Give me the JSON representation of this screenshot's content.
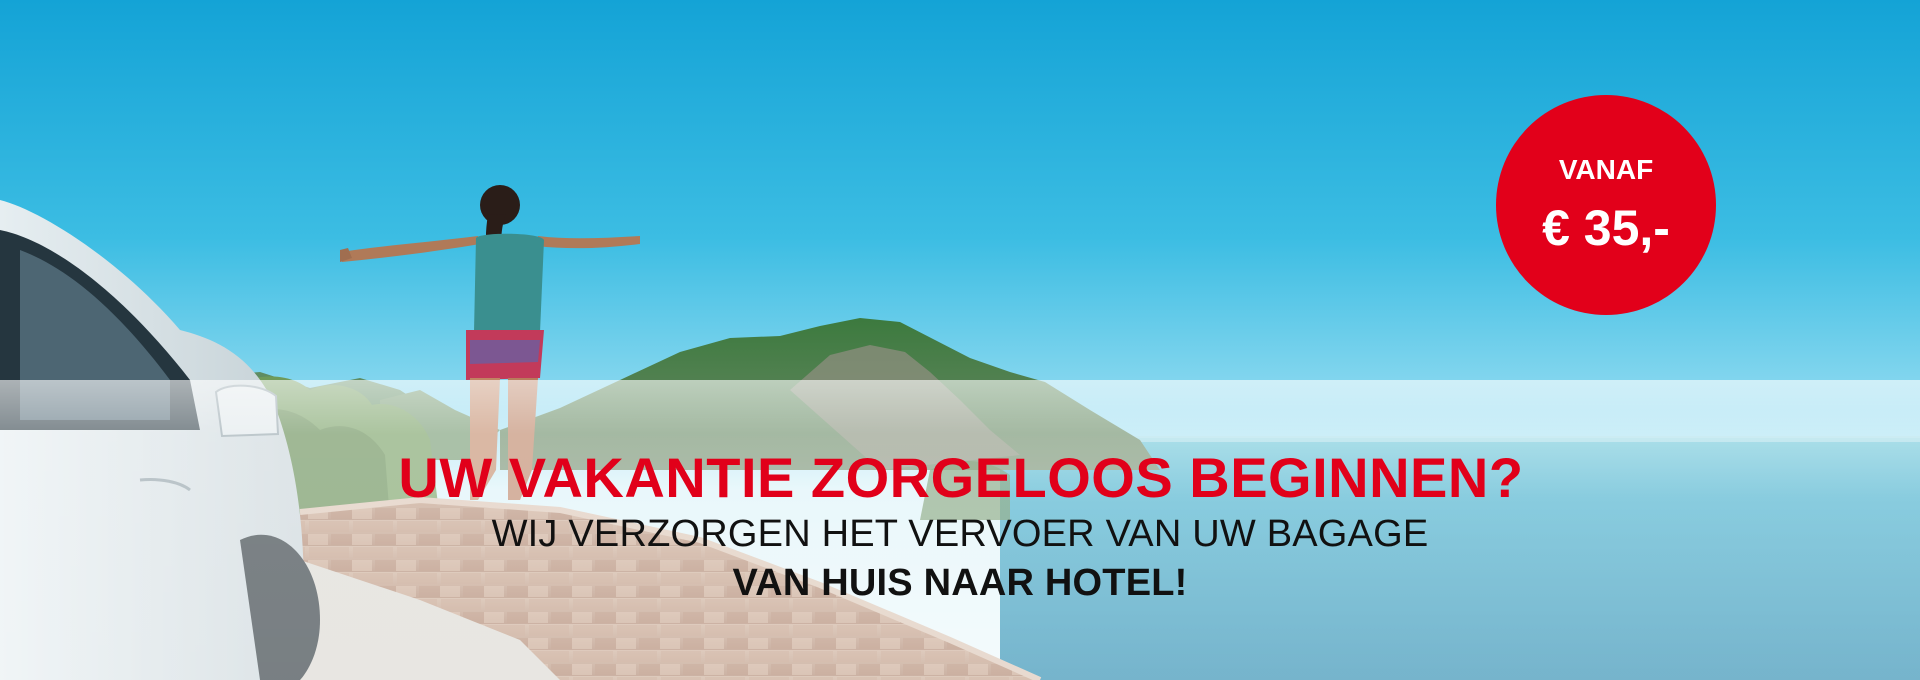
{
  "hero": {
    "headline": "UW VAKANTIE ZORGELOOS BEGINNEN?",
    "subline": "WIJ VERZORGEN HET VERVOER VAN UW BAGAGE",
    "subline_strong": "VAN HUIS NAAR HOTEL!"
  },
  "price_badge": {
    "label": "VANAF",
    "value": "€ 35,-"
  },
  "colors": {
    "accent_red": "#e2001a",
    "sky_top": "#1aa6d6",
    "sea": "#1e8fb5"
  }
}
